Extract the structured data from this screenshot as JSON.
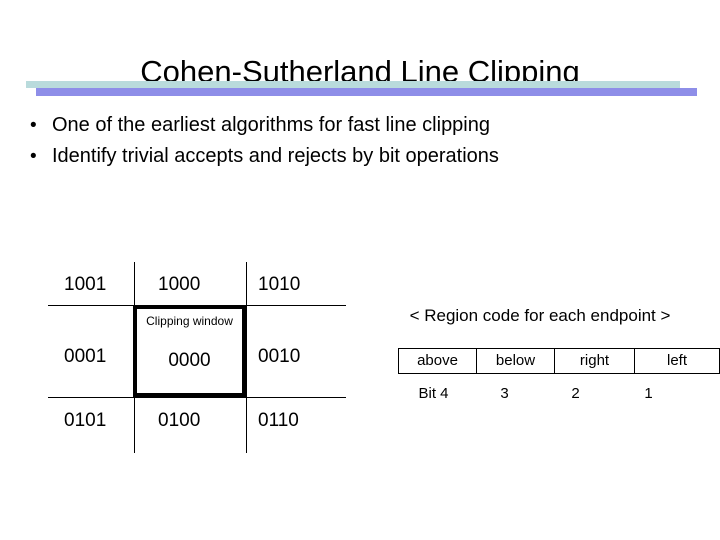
{
  "slide": {
    "title": "Cohen-Sutherland Line Clipping",
    "bullet_marker": "•",
    "bullets": [
      "One of the earliest algorithms for fast line clipping",
      "Identify trivial accepts and rejects by bit operations"
    ],
    "colors": {
      "background": "#ffffff",
      "text": "#000000",
      "divider_top": "#b9dbdc",
      "divider_bottom": "#8e8ee8"
    }
  },
  "region_grid": {
    "codes": {
      "top_left": "1001",
      "top_center": "1000",
      "top_right": "1010",
      "middle_left": "0001",
      "middle_center": "0000",
      "middle_right": "0010",
      "bottom_left": "0101",
      "bottom_center": "0100",
      "bottom_right": "0110"
    },
    "clipping_window_label": "Clipping window"
  },
  "caption": "< Region code for each endpoint >",
  "bit_table": {
    "headers": [
      "above",
      "below",
      "right",
      "left"
    ],
    "bits": [
      "Bit 4",
      "3",
      "2",
      "1"
    ]
  }
}
